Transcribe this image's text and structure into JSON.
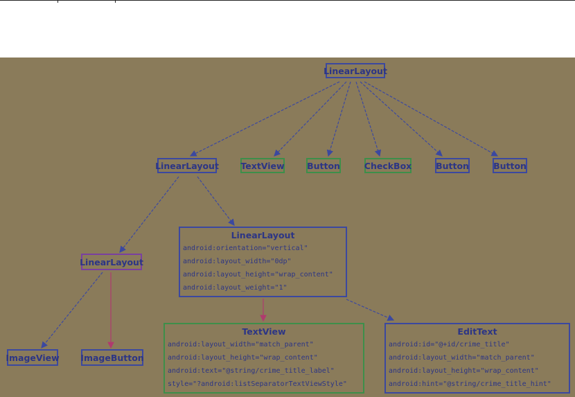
{
  "diagram": {
    "root": {
      "label": "LinearLayout"
    },
    "children": [
      {
        "label": "LinearLayout"
      },
      {
        "label": "TextView"
      },
      {
        "label": "Button"
      },
      {
        "label": "CheckBox"
      },
      {
        "label": "Button"
      },
      {
        "label": "Button"
      }
    ],
    "left_layout": {
      "label": "LinearLayout",
      "children": [
        {
          "label": "ImageView"
        },
        {
          "label": "ImageButton"
        }
      ]
    },
    "detail_layout": {
      "title": "LinearLayout",
      "attrs": [
        "android:orientation=\"vertical\"",
        "android:layout_width=\"0dp\"",
        "android:layout_height=\"wrap_content\"",
        "android:layout_weight=\"1\""
      ]
    },
    "textview_box": {
      "title": "TextView",
      "attrs": [
        "android:layout_width=\"match_parent\"",
        "android:layout_height=\"wrap_content\"",
        "android:text=\"@string/crime_title_label\"",
        "style=\"?android:listSeparatorTextViewStyle\""
      ]
    },
    "edittext_box": {
      "title": "EditText",
      "attrs": [
        "android:id=\"@+id/crime_title\"",
        "android:layout_width=\"match_parent\"",
        "android:layout_height=\"wrap_content\"",
        "android:hint=\"@string/crime_title_hint\""
      ]
    }
  },
  "colors": {
    "background": "#8a7b5a",
    "border_blue": "#3b48a0",
    "border_green": "#3d8f4a",
    "edge_blue": "#3b48a0",
    "edge_red": "#b03a6e"
  }
}
